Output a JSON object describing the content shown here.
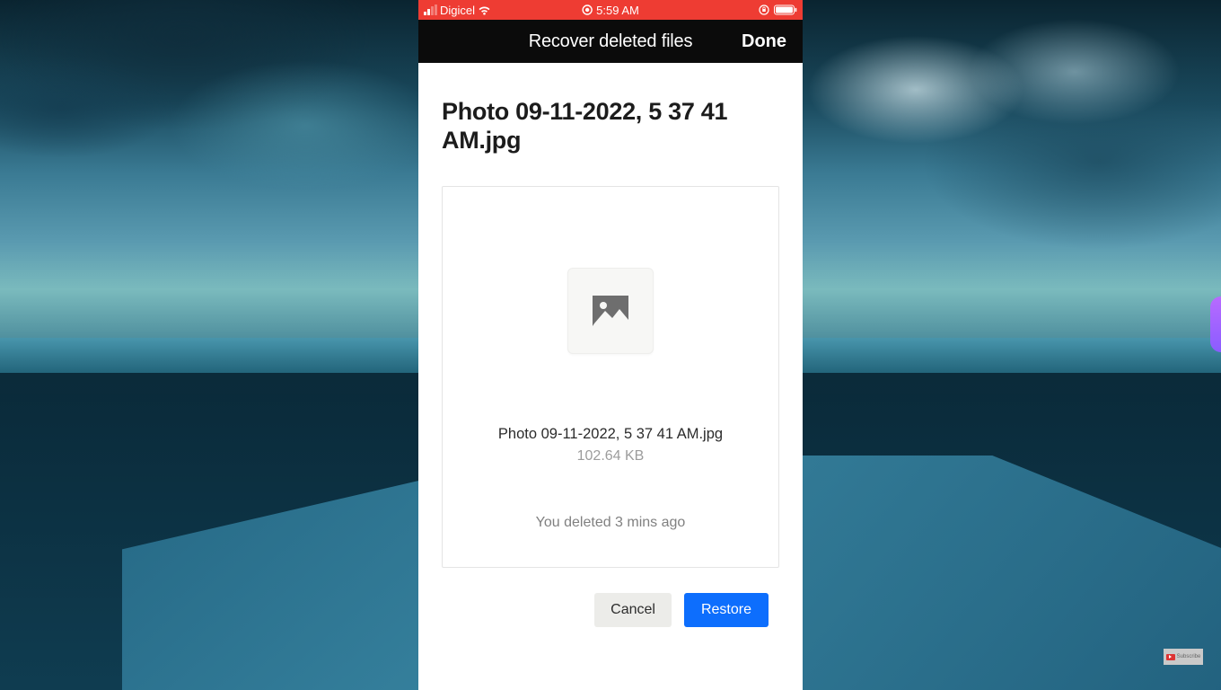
{
  "status_bar": {
    "carrier": "Digicel",
    "time": "5:59 AM"
  },
  "nav": {
    "title": "Recover deleted files",
    "done_label": "Done"
  },
  "file": {
    "title": "Photo 09-11-2022, 5 37 41 AM.jpg",
    "preview_name": "Photo 09-11-2022, 5 37 41 AM.jpg",
    "size": "102.64 KB",
    "deleted_text": "You deleted 3 mins ago"
  },
  "actions": {
    "cancel_label": "Cancel",
    "restore_label": "Restore"
  },
  "badge": {
    "label": "Subscribe"
  }
}
